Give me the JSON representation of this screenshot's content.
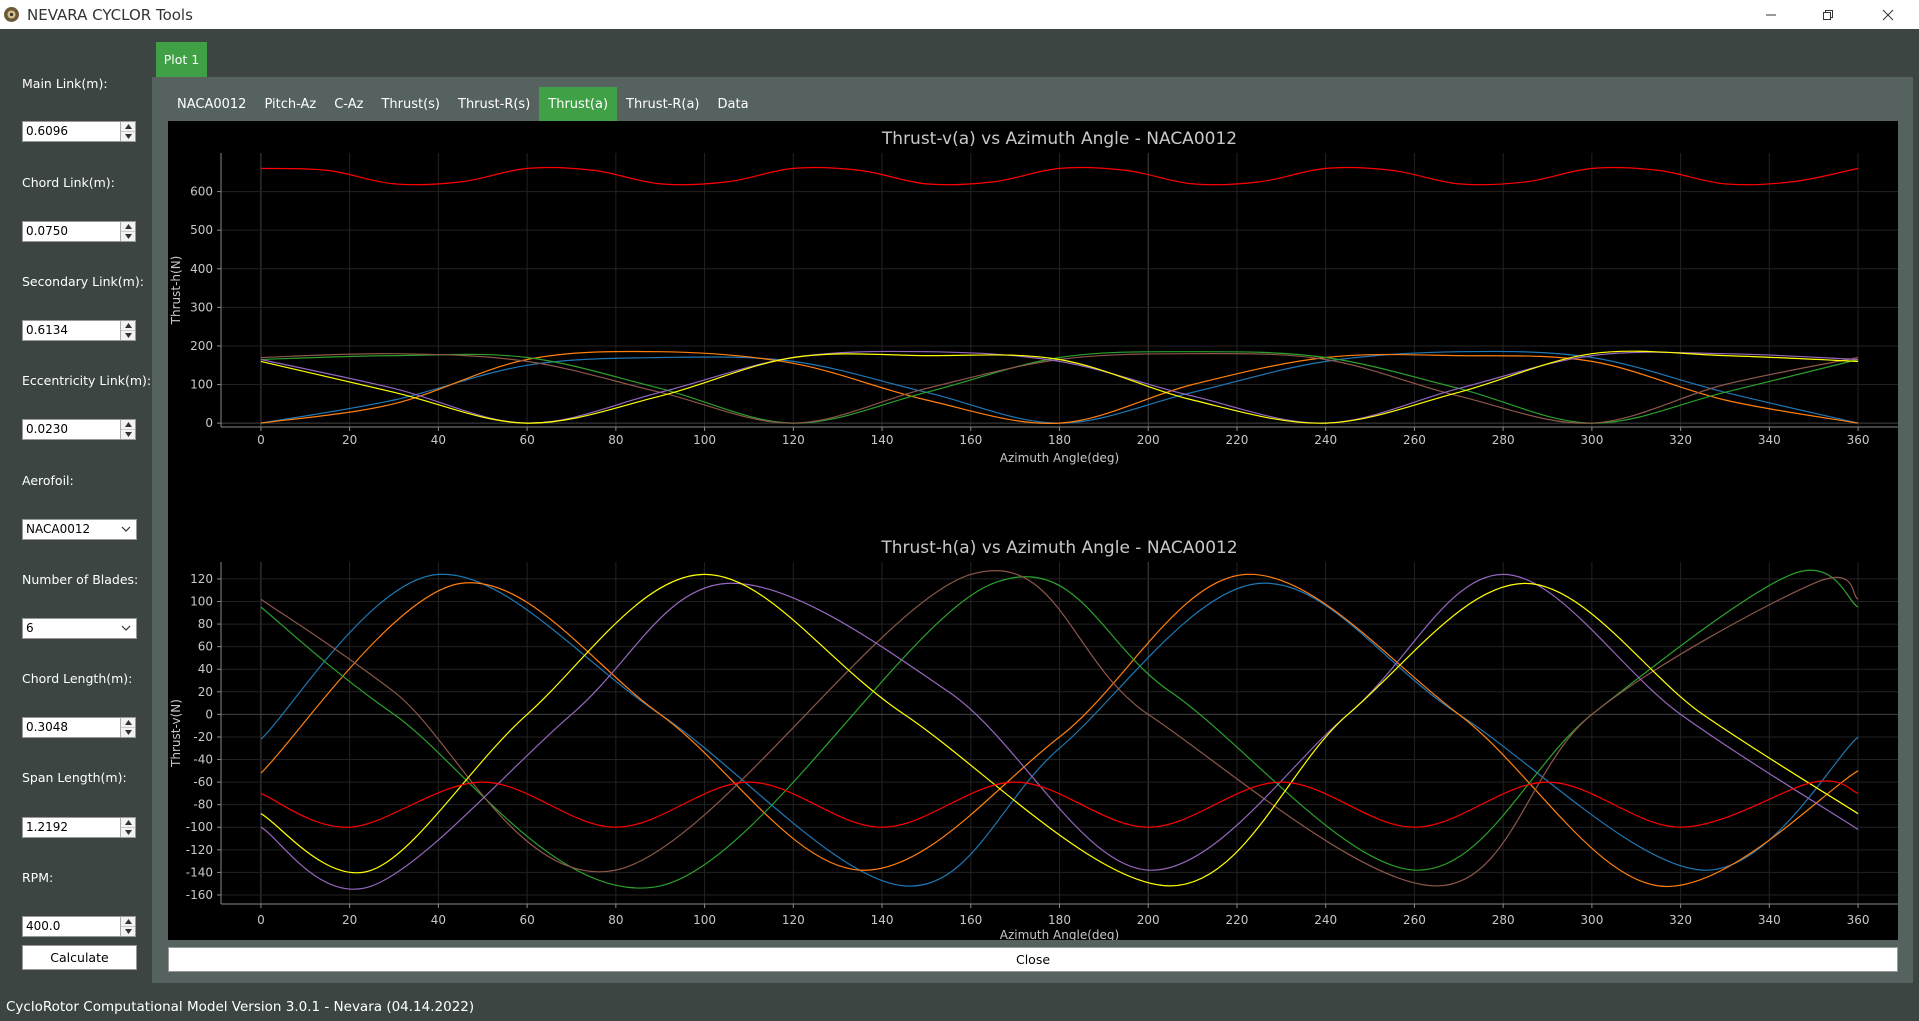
{
  "window": {
    "title": "NEVARA CYCLOR Tools",
    "controls": [
      "minimize-icon",
      "restore-icon",
      "close-icon"
    ]
  },
  "sidebar": {
    "main_link": {
      "label": "Main Link(m):",
      "value": "0.6096"
    },
    "chord_link": {
      "label": "Chord Link(m):",
      "value": "0.0750"
    },
    "secondary_link": {
      "label": "Secondary Link(m):",
      "value": "0.6134"
    },
    "eccentricity_link": {
      "label": "Eccentricity Link(m):",
      "value": "0.0230"
    },
    "aerofoil": {
      "label": "Aerofoil:",
      "value": "NACA0012"
    },
    "blades": {
      "label": "Number of Blades:",
      "value": "6"
    },
    "chord_length": {
      "label": "Chord Length(m):",
      "value": "0.3048"
    },
    "span_length": {
      "label": "Span Length(m):",
      "value": "1.2192"
    },
    "rpm": {
      "label": "RPM:",
      "value": "400.0"
    },
    "calculate_label": "Calculate"
  },
  "plot_tab": "Plot 1",
  "tabs": [
    {
      "label": "NACA0012"
    },
    {
      "label": "Pitch-Az"
    },
    {
      "label": "C-Az"
    },
    {
      "label": "Thrust(s)"
    },
    {
      "label": "Thrust-R(s)"
    },
    {
      "label": "Thrust(a)"
    },
    {
      "label": "Thrust-R(a)"
    },
    {
      "label": "Data"
    }
  ],
  "active_tab": "Thrust(a)",
  "close_label": "Close",
  "status": "CycloRotor Computational Model Version 3.0.1 - Nevara (04.14.2022)",
  "colors": {
    "accent": "#3fa046",
    "series": [
      "#1f77b4",
      "#ff7f0e",
      "#2ca02c",
      "#8c564b",
      "#9467bd",
      "#ffff00"
    ],
    "total": "#ff0000"
  },
  "chart_data": [
    {
      "type": "line",
      "title": "Thrust-v(a) vs Azimuth Angle - NACA0012",
      "xlabel": "Azimuth Angle(deg)",
      "ylabel": "Thrust-h(N)",
      "xlim": [
        -9,
        369
      ],
      "ylim": [
        -10,
        700
      ],
      "xticks": [
        0,
        20,
        40,
        60,
        80,
        100,
        120,
        140,
        160,
        180,
        200,
        220,
        240,
        260,
        280,
        300,
        320,
        340,
        360
      ],
      "yticks": [
        0,
        100,
        200,
        300,
        400,
        500,
        600
      ],
      "grid": true,
      "series": [
        {
          "color": "#1f77b4",
          "x": [
            0,
            30,
            60,
            90,
            120,
            150,
            180,
            210,
            240,
            270,
            300,
            330,
            360
          ],
          "y": [
            0,
            60,
            150,
            170,
            160,
            80,
            0,
            80,
            160,
            185,
            170,
            80,
            0
          ]
        },
        {
          "color": "#ff7f0e",
          "x": [
            0,
            30,
            60,
            90,
            120,
            150,
            180,
            210,
            240,
            270,
            300,
            330,
            360
          ],
          "y": [
            0,
            50,
            165,
            185,
            155,
            60,
            0,
            100,
            170,
            175,
            160,
            60,
            0
          ]
        },
        {
          "color": "#2ca02c",
          "x": [
            0,
            30,
            60,
            90,
            120,
            150,
            180,
            210,
            240,
            270,
            300,
            330,
            360
          ],
          "y": [
            165,
            175,
            170,
            90,
            0,
            80,
            170,
            185,
            170,
            90,
            0,
            80,
            165
          ]
        },
        {
          "color": "#8c564b",
          "x": [
            0,
            30,
            60,
            90,
            120,
            150,
            180,
            210,
            240,
            270,
            300,
            330,
            360
          ],
          "y": [
            170,
            180,
            160,
            80,
            0,
            90,
            165,
            180,
            165,
            70,
            0,
            100,
            170
          ]
        },
        {
          "color": "#9467bd",
          "x": [
            0,
            30,
            60,
            90,
            120,
            150,
            180,
            210,
            240,
            270,
            300,
            330,
            360
          ],
          "y": [
            165,
            90,
            0,
            80,
            170,
            185,
            160,
            70,
            0,
            90,
            175,
            180,
            165
          ]
        },
        {
          "color": "#ffff00",
          "x": [
            0,
            30,
            60,
            90,
            120,
            150,
            180,
            210,
            240,
            270,
            300,
            330,
            360
          ],
          "y": [
            160,
            80,
            0,
            70,
            170,
            175,
            165,
            60,
            0,
            80,
            180,
            175,
            160
          ]
        },
        {
          "color": "#ff0000",
          "x": [
            0,
            15,
            30,
            45,
            60,
            75,
            90,
            105,
            120,
            135,
            150,
            165,
            180,
            195,
            210,
            225,
            240,
            255,
            270,
            285,
            300,
            315,
            330,
            345,
            360
          ],
          "y": [
            660,
            655,
            620,
            625,
            660,
            655,
            620,
            625,
            660,
            655,
            620,
            625,
            660,
            655,
            620,
            625,
            660,
            655,
            620,
            625,
            660,
            655,
            620,
            625,
            660
          ]
        }
      ]
    },
    {
      "type": "line",
      "title": "Thrust-h(a) vs Azimuth Angle - NACA0012",
      "xlabel": "Azimuth Angle(deg)",
      "ylabel": "Thrust-v(N)",
      "xlim": [
        -9,
        369
      ],
      "ylim": [
        -168,
        135
      ],
      "xticks": [
        0,
        20,
        40,
        60,
        80,
        100,
        120,
        140,
        160,
        180,
        200,
        220,
        240,
        260,
        280,
        300,
        320,
        340,
        360
      ],
      "yticks": [
        120,
        100,
        80,
        60,
        40,
        20,
        0,
        -20,
        -40,
        -60,
        -80,
        -100,
        -120,
        -140,
        -160
      ],
      "grid": true,
      "series": [
        {
          "color": "#1f77b4",
          "x": [
            0,
            40,
            90,
            145,
            180,
            225,
            270,
            325,
            360
          ],
          "y": [
            -22,
            124,
            0,
            -152,
            -30,
            116,
            0,
            -138,
            -20
          ]
        },
        {
          "color": "#ff7f0e",
          "x": [
            0,
            45,
            90,
            135,
            180,
            222,
            270,
            315,
            360
          ],
          "y": [
            -52,
            116,
            0,
            -138,
            -20,
            124,
            0,
            -152,
            -50
          ]
        },
        {
          "color": "#2ca02c",
          "x": [
            0,
            30,
            90,
            165,
            205,
            260,
            300,
            345,
            360
          ],
          "y": [
            95,
            0,
            -152,
            116,
            20,
            -138,
            0,
            124,
            95
          ]
        },
        {
          "color": "#8c564b",
          "x": [
            0,
            30,
            80,
            160,
            200,
            265,
            300,
            350,
            360
          ],
          "y": [
            102,
            20,
            -138,
            124,
            0,
            -152,
            0,
            116,
            102
          ]
        },
        {
          "color": "#9467bd",
          "x": [
            0,
            25,
            70,
            105,
            155,
            200,
            245,
            280,
            320,
            360
          ],
          "y": [
            -100,
            -152,
            0,
            116,
            20,
            -138,
            0,
            124,
            0,
            -102
          ]
        },
        {
          "color": "#ffff00",
          "x": [
            0,
            25,
            60,
            100,
            145,
            205,
            245,
            285,
            325,
            360
          ],
          "y": [
            -88,
            -138,
            0,
            124,
            0,
            -152,
            0,
            116,
            0,
            -88
          ]
        },
        {
          "color": "#ff0000",
          "x": [
            0,
            20,
            50,
            80,
            110,
            140,
            170,
            200,
            230,
            260,
            290,
            320,
            350,
            360
          ],
          "y": [
            -70,
            -100,
            -60,
            -100,
            -60,
            -100,
            -60,
            -100,
            -60,
            -100,
            -60,
            -100,
            -60,
            -70
          ]
        }
      ]
    }
  ]
}
